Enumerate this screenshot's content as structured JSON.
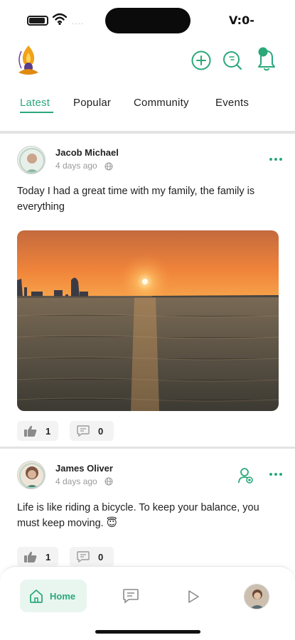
{
  "status_bar": {
    "time": "V:0-"
  },
  "tabs": [
    {
      "label": "Latest"
    },
    {
      "label": "Popular"
    },
    {
      "label": "Community"
    },
    {
      "label": "Events"
    }
  ],
  "posts": [
    {
      "author": "Jacob Michael",
      "time": "4 days ago",
      "text": "Today I had a great time with my family, the family is everything",
      "likes": "1",
      "comments": "0"
    },
    {
      "author": "James Oliver",
      "time": "4 days ago",
      "text": "Life is like riding a bicycle. To keep your balance, you must keep moving. 😇",
      "likes": "1",
      "comments": "0"
    }
  ],
  "bottom_nav": {
    "home_label": "Home"
  },
  "icons": {
    "brand_logo": "brand-logo",
    "create": "plus-circle-icon",
    "search": "search-icon",
    "notifications": "bell-icon",
    "like": "thumbs-up-icon",
    "comment": "comment-icon",
    "more": "more-dots-icon",
    "follow": "add-user-icon",
    "home": "home-icon",
    "chat": "chat-icon",
    "video": "play-icon"
  },
  "colors": {
    "accent": "#2aa87a",
    "text": "#1f1f1f",
    "muted": "#9a9a9a"
  }
}
